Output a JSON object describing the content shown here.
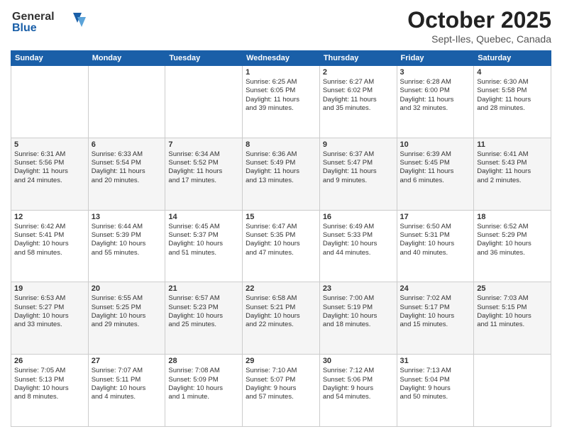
{
  "logo": {
    "line1": "General",
    "line2": "Blue"
  },
  "title": "October 2025",
  "location": "Sept-Iles, Quebec, Canada",
  "days_header": [
    "Sunday",
    "Monday",
    "Tuesday",
    "Wednesday",
    "Thursday",
    "Friday",
    "Saturday"
  ],
  "weeks": [
    [
      {
        "num": "",
        "content": ""
      },
      {
        "num": "",
        "content": ""
      },
      {
        "num": "",
        "content": ""
      },
      {
        "num": "1",
        "content": "Sunrise: 6:25 AM\nSunset: 6:05 PM\nDaylight: 11 hours\nand 39 minutes."
      },
      {
        "num": "2",
        "content": "Sunrise: 6:27 AM\nSunset: 6:02 PM\nDaylight: 11 hours\nand 35 minutes."
      },
      {
        "num": "3",
        "content": "Sunrise: 6:28 AM\nSunset: 6:00 PM\nDaylight: 11 hours\nand 32 minutes."
      },
      {
        "num": "4",
        "content": "Sunrise: 6:30 AM\nSunset: 5:58 PM\nDaylight: 11 hours\nand 28 minutes."
      }
    ],
    [
      {
        "num": "5",
        "content": "Sunrise: 6:31 AM\nSunset: 5:56 PM\nDaylight: 11 hours\nand 24 minutes."
      },
      {
        "num": "6",
        "content": "Sunrise: 6:33 AM\nSunset: 5:54 PM\nDaylight: 11 hours\nand 20 minutes."
      },
      {
        "num": "7",
        "content": "Sunrise: 6:34 AM\nSunset: 5:52 PM\nDaylight: 11 hours\nand 17 minutes."
      },
      {
        "num": "8",
        "content": "Sunrise: 6:36 AM\nSunset: 5:49 PM\nDaylight: 11 hours\nand 13 minutes."
      },
      {
        "num": "9",
        "content": "Sunrise: 6:37 AM\nSunset: 5:47 PM\nDaylight: 11 hours\nand 9 minutes."
      },
      {
        "num": "10",
        "content": "Sunrise: 6:39 AM\nSunset: 5:45 PM\nDaylight: 11 hours\nand 6 minutes."
      },
      {
        "num": "11",
        "content": "Sunrise: 6:41 AM\nSunset: 5:43 PM\nDaylight: 11 hours\nand 2 minutes."
      }
    ],
    [
      {
        "num": "12",
        "content": "Sunrise: 6:42 AM\nSunset: 5:41 PM\nDaylight: 10 hours\nand 58 minutes."
      },
      {
        "num": "13",
        "content": "Sunrise: 6:44 AM\nSunset: 5:39 PM\nDaylight: 10 hours\nand 55 minutes."
      },
      {
        "num": "14",
        "content": "Sunrise: 6:45 AM\nSunset: 5:37 PM\nDaylight: 10 hours\nand 51 minutes."
      },
      {
        "num": "15",
        "content": "Sunrise: 6:47 AM\nSunset: 5:35 PM\nDaylight: 10 hours\nand 47 minutes."
      },
      {
        "num": "16",
        "content": "Sunrise: 6:49 AM\nSunset: 5:33 PM\nDaylight: 10 hours\nand 44 minutes."
      },
      {
        "num": "17",
        "content": "Sunrise: 6:50 AM\nSunset: 5:31 PM\nDaylight: 10 hours\nand 40 minutes."
      },
      {
        "num": "18",
        "content": "Sunrise: 6:52 AM\nSunset: 5:29 PM\nDaylight: 10 hours\nand 36 minutes."
      }
    ],
    [
      {
        "num": "19",
        "content": "Sunrise: 6:53 AM\nSunset: 5:27 PM\nDaylight: 10 hours\nand 33 minutes."
      },
      {
        "num": "20",
        "content": "Sunrise: 6:55 AM\nSunset: 5:25 PM\nDaylight: 10 hours\nand 29 minutes."
      },
      {
        "num": "21",
        "content": "Sunrise: 6:57 AM\nSunset: 5:23 PM\nDaylight: 10 hours\nand 25 minutes."
      },
      {
        "num": "22",
        "content": "Sunrise: 6:58 AM\nSunset: 5:21 PM\nDaylight: 10 hours\nand 22 minutes."
      },
      {
        "num": "23",
        "content": "Sunrise: 7:00 AM\nSunset: 5:19 PM\nDaylight: 10 hours\nand 18 minutes."
      },
      {
        "num": "24",
        "content": "Sunrise: 7:02 AM\nSunset: 5:17 PM\nDaylight: 10 hours\nand 15 minutes."
      },
      {
        "num": "25",
        "content": "Sunrise: 7:03 AM\nSunset: 5:15 PM\nDaylight: 10 hours\nand 11 minutes."
      }
    ],
    [
      {
        "num": "26",
        "content": "Sunrise: 7:05 AM\nSunset: 5:13 PM\nDaylight: 10 hours\nand 8 minutes."
      },
      {
        "num": "27",
        "content": "Sunrise: 7:07 AM\nSunset: 5:11 PM\nDaylight: 10 hours\nand 4 minutes."
      },
      {
        "num": "28",
        "content": "Sunrise: 7:08 AM\nSunset: 5:09 PM\nDaylight: 10 hours\nand 1 minute."
      },
      {
        "num": "29",
        "content": "Sunrise: 7:10 AM\nSunset: 5:07 PM\nDaylight: 9 hours\nand 57 minutes."
      },
      {
        "num": "30",
        "content": "Sunrise: 7:12 AM\nSunset: 5:06 PM\nDaylight: 9 hours\nand 54 minutes."
      },
      {
        "num": "31",
        "content": "Sunrise: 7:13 AM\nSunset: 5:04 PM\nDaylight: 9 hours\nand 50 minutes."
      },
      {
        "num": "",
        "content": ""
      }
    ]
  ]
}
